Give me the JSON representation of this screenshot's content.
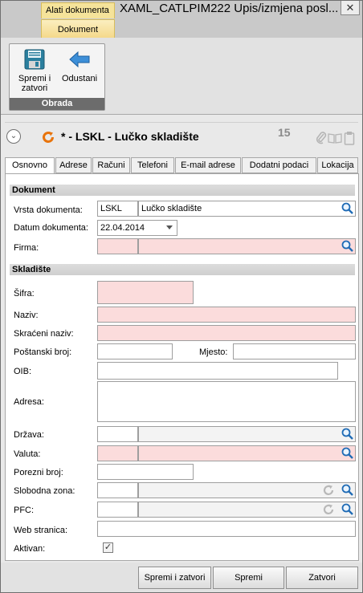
{
  "window": {
    "context_tab": "Alati dokumenta",
    "title": "XAML_CATLPIM222  Upis/izmjena posl...",
    "close_glyph": "✕"
  },
  "ribbon": {
    "tab": "Dokument",
    "group_label": "Obrada",
    "save_close": "Spremi i zatvori",
    "cancel": "Odustani"
  },
  "header": {
    "title": "*  -  LSKL  -  Lučko skladište",
    "count": "15"
  },
  "tabs": [
    "Osnovno",
    "Adrese",
    "Računi",
    "Telefoni",
    "E-mail adrese",
    "Dodatni podaci",
    "Lokacija"
  ],
  "sections": {
    "dokument": "Dokument",
    "skladiste": "Skladište"
  },
  "fields": {
    "vrsta_label": "Vrsta dokumenta:",
    "vrsta_code": "LSKL",
    "vrsta_name": "Lučko skladište",
    "datum_label": "Datum dokumenta:",
    "datum_value": "22.04.2014",
    "firma_label": "Firma:",
    "sifra_label": "Šifra:",
    "naziv_label": "Naziv:",
    "skraceni_label": "Skraćeni naziv:",
    "postanski_label": "Poštanski broj:",
    "mjesto_label": "Mjesto:",
    "oib_label": "OIB:",
    "adresa_label": "Adresa:",
    "drzava_label": "Država:",
    "valuta_label": "Valuta:",
    "porezni_label": "Porezni broj:",
    "slobodna_label": "Slobodna zona:",
    "pfc_label": "PFC:",
    "web_label": "Web stranica:",
    "aktivan_label": "Aktivan:",
    "aktivan_checked": "✓"
  },
  "footer": {
    "save_close": "Spremi i zatvori",
    "save": "Spremi",
    "close": "Zatvori"
  },
  "colors": {
    "required_bg": "#fbdcdc",
    "ribbon_tab": "#f4d88a",
    "group_label_bg": "#6c6c6c",
    "accent_orange": "#e8740c"
  }
}
